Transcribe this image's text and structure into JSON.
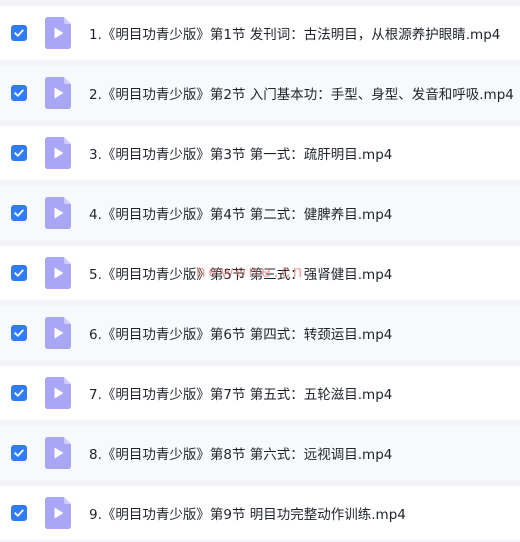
{
  "colors": {
    "checkbox": "#2f7cf6",
    "file_icon": "#a9a6f5",
    "watermark": "#e26060"
  },
  "icons": {
    "checkbox": "check-icon",
    "file": "video-file-icon"
  },
  "files": [
    {
      "name": "1.《明目功青少版》第1节 发刊词：古法明目，从根源养护眼睛.mp4",
      "checked": true
    },
    {
      "name": "2.《明目功青少版》第2节 入门基本功：手型、身型、发音和呼吸.mp4",
      "checked": true
    },
    {
      "name": "3.《明目功青少版》第3节 第一式：疏肝明目.mp4",
      "checked": true
    },
    {
      "name": "4.《明目功青少版》第4节 第二式：健脾养目.mp4",
      "checked": true
    },
    {
      "name": "5.《明目功青少版》第5节 第三式：强肾健目.mp4",
      "checked": true
    },
    {
      "name": "6.《明目功青少版》第6节 第四式：转颈运目.mp4",
      "checked": true
    },
    {
      "name": "7.《明目功青少版》第7节 第五式：五轮滋目.mp4",
      "checked": true
    },
    {
      "name": "8.《明目功青少版》第8节 第六式：远视调目.mp4",
      "checked": true
    },
    {
      "name": "9.《明目功青少版》第9节 明目功完整动作训练.mp4",
      "checked": true
    }
  ],
  "watermark": "newone.cn"
}
